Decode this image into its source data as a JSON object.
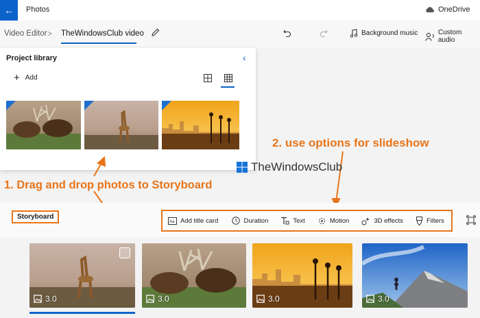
{
  "app": {
    "title": "Photos",
    "onedrive_label": "OneDrive"
  },
  "toolbar": {
    "breadcrumb_root": "Video Editor",
    "breadcrumb_separator": ">",
    "project_name": "TheWindowsClub video",
    "background_music": "Background music",
    "custom_audio": "Custom audio"
  },
  "library": {
    "title": "Project library",
    "add_label": "Add",
    "thumbnails": [
      {
        "name": "deer-fighting"
      },
      {
        "name": "giraffe"
      },
      {
        "name": "city-sunset"
      }
    ]
  },
  "annotations": {
    "step1": "1. Drag and drop photos to Storyboard",
    "step2": "2. use options for slideshow",
    "watermark": "TheWindowsClub"
  },
  "storyboard": {
    "label": "Storyboard",
    "options": [
      "Add title card",
      "Duration",
      "Text",
      "Motion",
      "3D effects",
      "Filters"
    ],
    "cards": [
      {
        "name": "giraffe",
        "duration": "3.0"
      },
      {
        "name": "deer-fighting",
        "duration": "3.0"
      },
      {
        "name": "city-sunset",
        "duration": "3.0"
      },
      {
        "name": "mountain-hiker",
        "duration": "3.0"
      }
    ]
  },
  "colors": {
    "accent": "#0b63c9",
    "annotation": "#e8751a"
  }
}
